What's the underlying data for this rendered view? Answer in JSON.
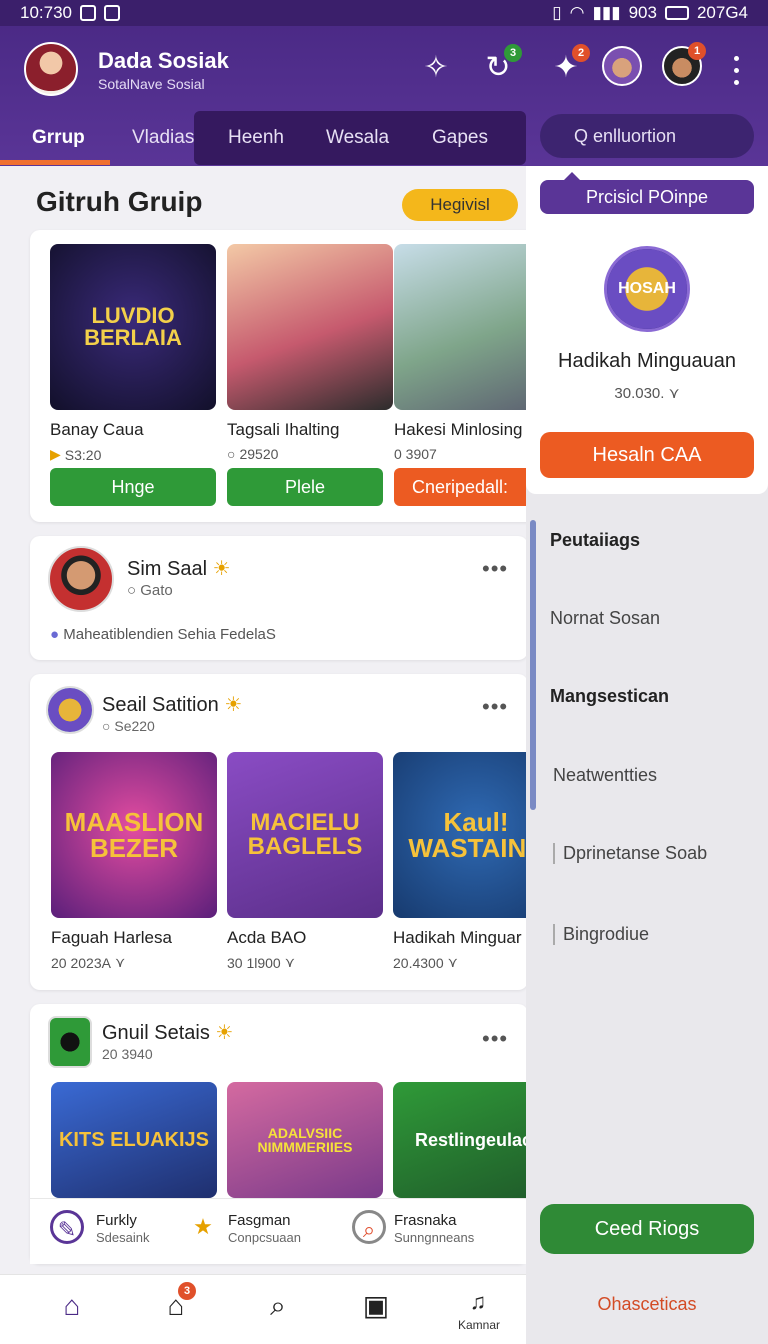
{
  "status_bar": {
    "time": "10:730",
    "right": "903",
    "battery_text": "207G4"
  },
  "header": {
    "title": "Dada Sosiak",
    "subtitle": "SotalNave Sosial",
    "icons": [
      "sparkle-icon",
      "refresh-icon",
      "puzzle-icon"
    ],
    "badges": {
      "refresh": "3",
      "puzzle": "2",
      "avatar2": "1"
    }
  },
  "tabs": [
    {
      "label": "Grrup"
    },
    {
      "label": "Vladias"
    },
    {
      "label": "Heenh"
    },
    {
      "label": "Wesala"
    },
    {
      "label": "Gapes"
    }
  ],
  "search": {
    "placeholder": "Q enlluortion"
  },
  "section": {
    "title": "Gitruh Gruip",
    "chip": "Hegivisl"
  },
  "featured_games": [
    {
      "thumb": "LUVDIO BERLAIA",
      "title": "Banay Caua",
      "meta": "S3:20",
      "button": "Hnge"
    },
    {
      "thumb": "",
      "title": "Tagsali Ihalting",
      "meta": "29520",
      "button": "Plele"
    },
    {
      "thumb": "",
      "title": "Hakesi Minlosing",
      "meta": "0 3907",
      "button": "Cneripedall:"
    }
  ],
  "post1": {
    "name": "Sim Saal",
    "sub": "Gato",
    "text": "Maheatiblendien Sehia FedelaS"
  },
  "post2": {
    "name": "Seail Satition",
    "sub": "Se220",
    "games": [
      {
        "thumb": "MAASLION BEZER",
        "title": "Faguah Harlesa",
        "meta": "20 2023A"
      },
      {
        "thumb": "MACIELU BAGLELS",
        "title": "Acda BAO",
        "meta": "30 1l900"
      },
      {
        "thumb": "Kaul! WASTAINS",
        "title": "Hadikah Minguar",
        "meta": "20.4300"
      }
    ]
  },
  "post3": {
    "name": "Gnuil Setais",
    "sub": "20 3940",
    "games": [
      {
        "thumb": "KITS ELUAKIJS"
      },
      {
        "thumb": "ADALVSIIC NIMMMERIIES"
      },
      {
        "thumb": "Restlingeulaci"
      }
    ]
  },
  "shortcuts": [
    {
      "title": "Furkly",
      "sub": "Sdesaink"
    },
    {
      "title": "Fasgman",
      "sub": "Conpcsuaan"
    },
    {
      "title": "Frasnaka",
      "sub": "Sunngnneans"
    }
  ],
  "panel": {
    "pill": "Prcisicl POinpe",
    "logo_text": "HOSAH",
    "name": "Hadikah Minguauan",
    "meta": "30.030.",
    "button": "Hesaln CAA",
    "items": [
      {
        "label": "Peutaiiags",
        "bold": true
      },
      {
        "label": "Nornat Sosan",
        "bold": false
      },
      {
        "label": "Mangsestican",
        "bold": true
      },
      {
        "label": "Neatwentties",
        "bold": false
      },
      {
        "label": "Dprinetanse Soab",
        "bold": false
      },
      {
        "label": "Bingrodiue",
        "bold": false
      }
    ],
    "green_button": "Ceed Riogs",
    "footer_link": "Ohasceticas"
  },
  "bottom_nav": {
    "badge": "3",
    "last_label": "Kamnar"
  },
  "colors": {
    "brand": "#4b2a86",
    "accent": "#f07030",
    "green": "#2f9a38",
    "orange": "#ec5b22",
    "yellow": "#f4b71b"
  }
}
